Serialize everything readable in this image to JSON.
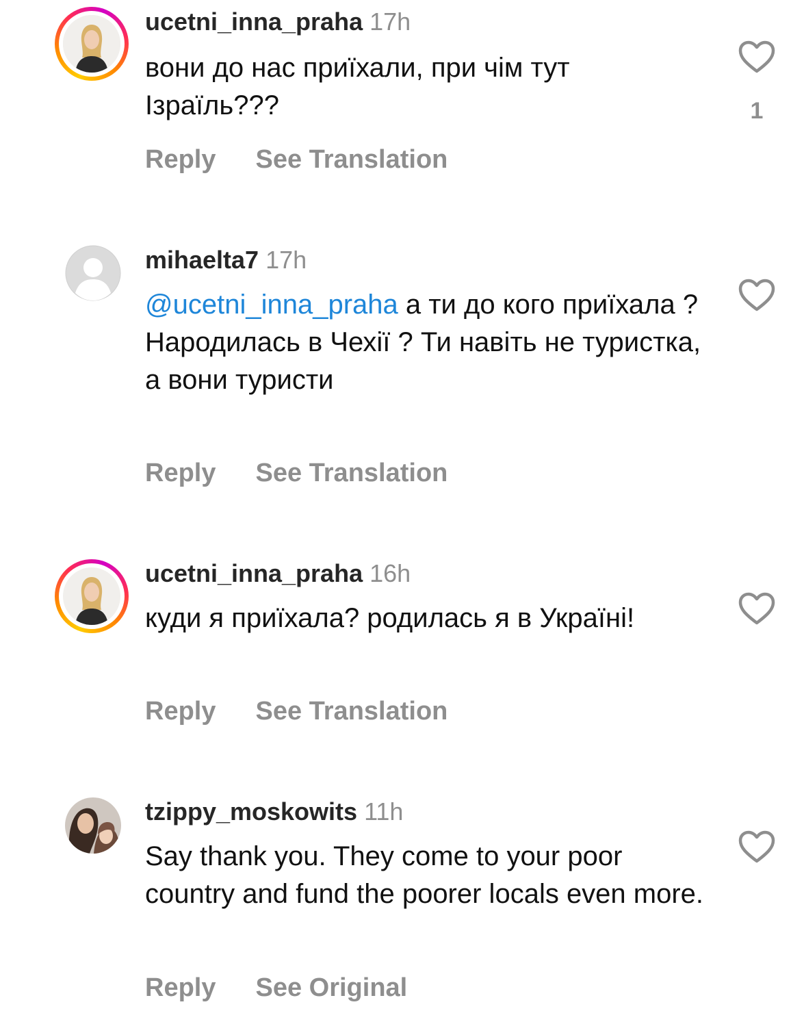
{
  "comments": [
    {
      "username": "ucetni_inna_praha",
      "time": "17h",
      "text": "вони до нас приїхали, при чім тут Ізраїль???",
      "likes": "1",
      "reply_label": "Reply",
      "translation_label": "See Translation"
    },
    {
      "username": "mihaelta7",
      "time": "17h",
      "mention": "@ucetni_inna_praha",
      "text": " а ти до кого приїхала ? Народилась в Чехії ? Ти навіть не туристка, а вони туристи",
      "reply_label": "Reply",
      "translation_label": "See Translation"
    },
    {
      "username": "ucetni_inna_praha",
      "time": "16h",
      "text": "куди я приїхала? родилась я в Україні!",
      "reply_label": "Reply",
      "translation_label": "See Translation"
    },
    {
      "username": "tzippy_moskowits",
      "time": "11h",
      "text": "Say thank you. They come to your poor country and fund the poorer locals even more.",
      "reply_label": "Reply",
      "translation_label": "See Original"
    }
  ],
  "colors": {
    "mention": "#1e86d9",
    "muted": "#8e8e8e",
    "story_ring": [
      "#ffcc00",
      "#ff2d55",
      "#d300c5"
    ]
  }
}
